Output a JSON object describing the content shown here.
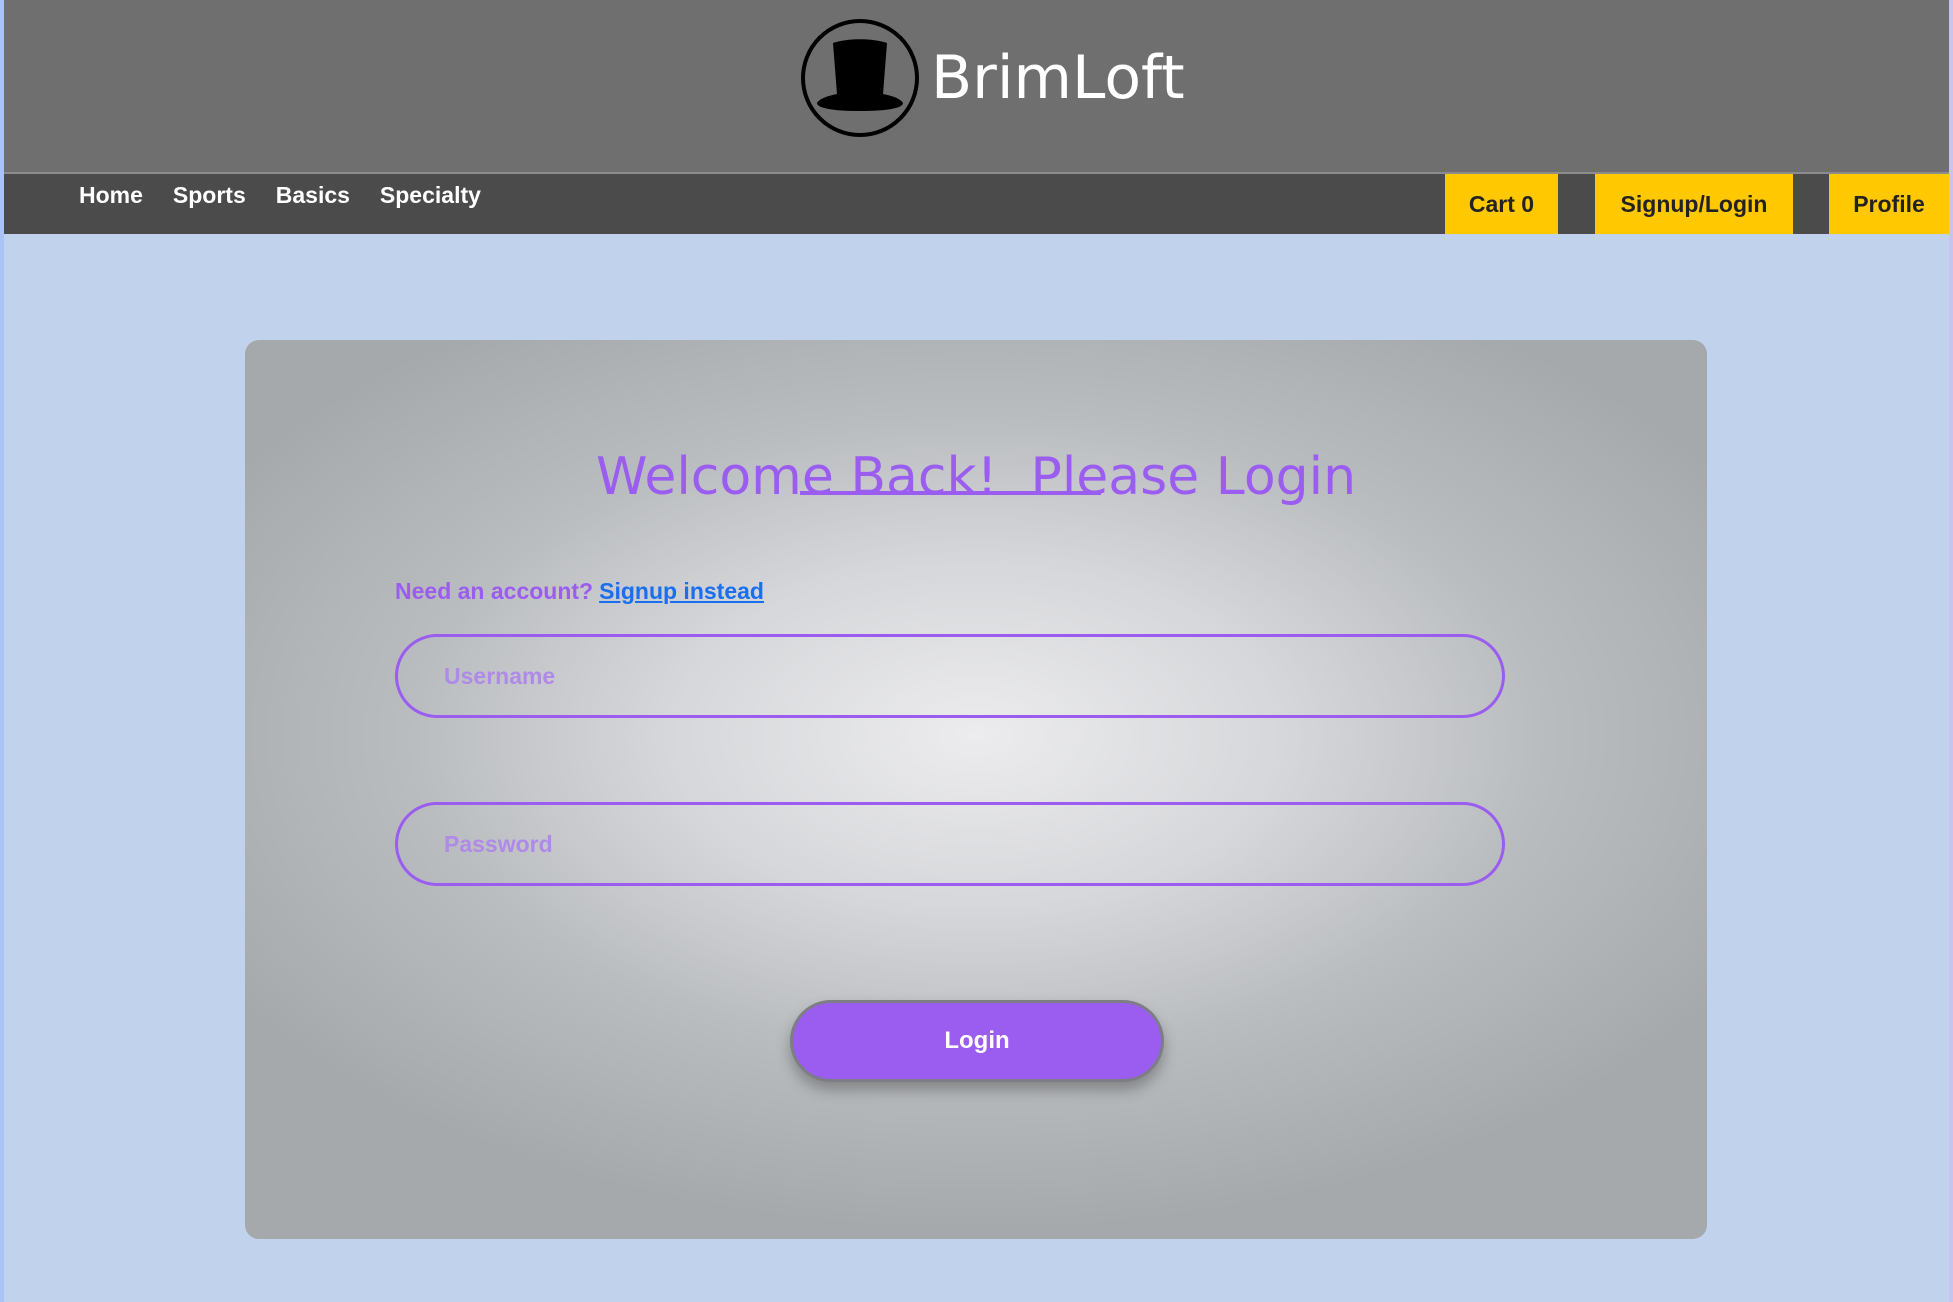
{
  "brand": {
    "name": "BrimLoft",
    "logo_icon": "top-hat-icon"
  },
  "nav": {
    "links": [
      "Home",
      "Sports",
      "Basics",
      "Specialty"
    ],
    "cart_label": "Cart 0",
    "signup_label": "Signup/Login",
    "profile_label": "Profile"
  },
  "login": {
    "title": "Welcome Back!  Please Login",
    "signup_prompt": "Need an account?",
    "signup_link": "Signup instead",
    "username_placeholder": "Username",
    "password_placeholder": "Password",
    "submit_label": "Login"
  },
  "colors": {
    "accent": "#9b5cf0",
    "nav_button": "#ffc800",
    "header_bg": "#6f6f6f",
    "navbar_bg": "#4b4b4b",
    "page_bg": "#c0d2ec",
    "link": "#1a6ef0"
  }
}
